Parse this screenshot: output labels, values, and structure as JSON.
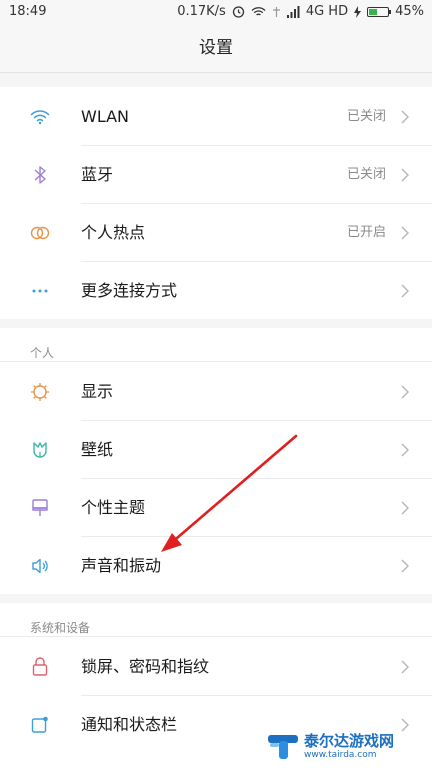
{
  "status_bar": {
    "time": "18:49",
    "speed": "0.17K/s",
    "network": "4G HD",
    "battery_percent": "45%",
    "battery_level": 0.45
  },
  "title": "设置",
  "connectivity": [
    {
      "label": "WLAN",
      "value": "已关闭",
      "icon": "wifi-icon"
    },
    {
      "label": "蓝牙",
      "value": "已关闭",
      "icon": "bluetooth-icon"
    },
    {
      "label": "个人热点",
      "value": "已开启",
      "icon": "hotspot-icon"
    },
    {
      "label": "更多连接方式",
      "value": "",
      "icon": "more-dots-icon"
    }
  ],
  "personal": {
    "header": "个人",
    "items": [
      {
        "label": "显示",
        "icon": "display-sun-icon"
      },
      {
        "label": "壁纸",
        "icon": "wallpaper-tulip-icon"
      },
      {
        "label": "个性主题",
        "icon": "theme-brush-icon"
      },
      {
        "label": "声音和振动",
        "icon": "speaker-icon"
      }
    ]
  },
  "system": {
    "header": "系统和设备",
    "items": [
      {
        "label": "锁屏、密码和指纹",
        "icon": "lock-icon"
      },
      {
        "label": "通知和状态栏",
        "icon": "notification-icon"
      }
    ]
  },
  "watermark": {
    "text": "泰尔达游戏网",
    "url": "www.tairda.com"
  },
  "colors": {
    "wifi": "#3aa0d8",
    "bluetooth": "#9b7fd4",
    "hotspot": "#e8944a",
    "more": "#3aa0d8",
    "display": "#e8944a",
    "wallpaper": "#3cb8a0",
    "theme": "#9b7fd4",
    "sound": "#3aa0d8",
    "lock": "#e0606a",
    "notification": "#3aa0d8",
    "annotation_arrow": "#e02020"
  }
}
